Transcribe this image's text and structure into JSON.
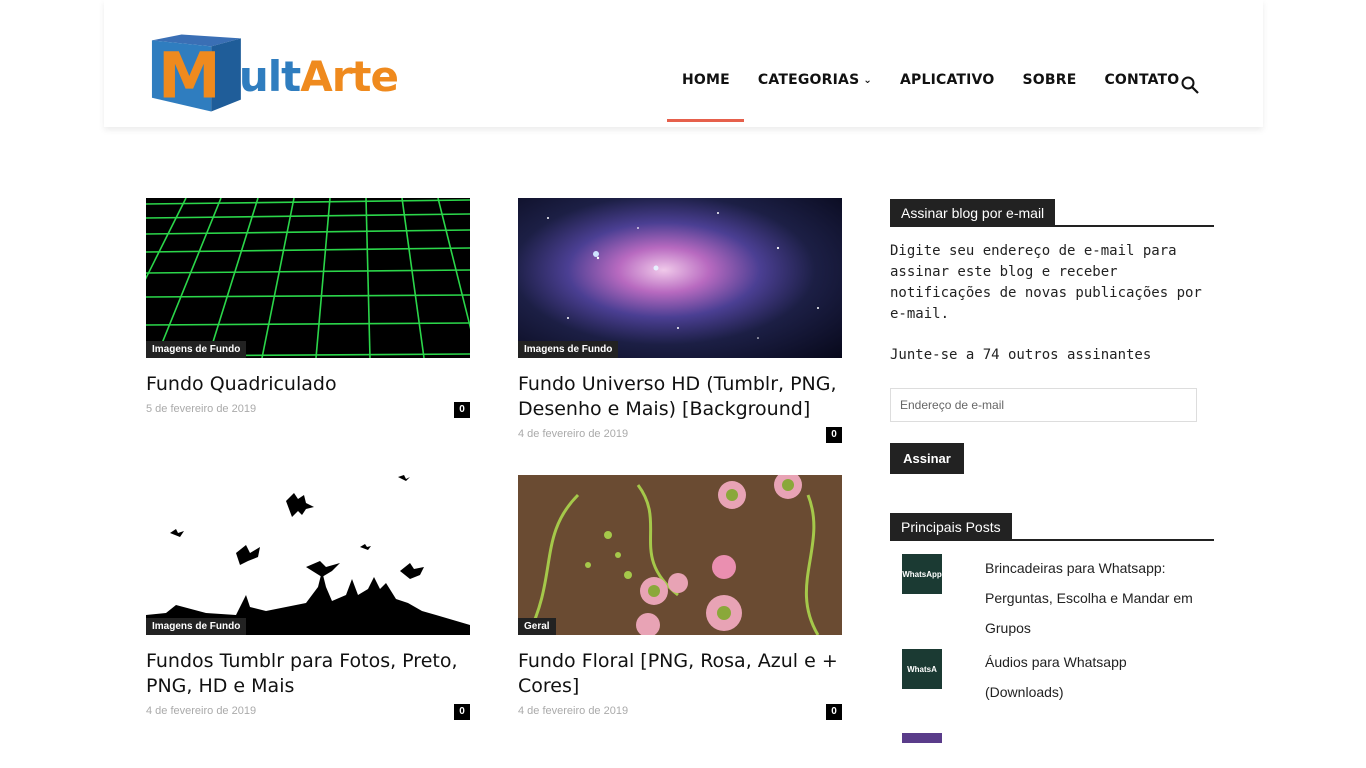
{
  "brand": {
    "logo_text_part1": "ult",
    "logo_text_part2": "Arte",
    "logo_letter": "M"
  },
  "nav": {
    "items": [
      {
        "label": "HOME",
        "active": true
      },
      {
        "label": "CATEGORIAS",
        "has_dropdown": true
      },
      {
        "label": "APLICATIVO"
      },
      {
        "label": "SOBRE"
      },
      {
        "label": "CONTATO"
      }
    ],
    "active_color": "#e6604c"
  },
  "posts": [
    {
      "title": "Fundo Quadriculado",
      "category": "Imagens de Fundo",
      "date": "5 de fevereiro de 2019",
      "comments": "0"
    },
    {
      "title": "Fundo Universo HD (Tumblr, PNG, Desenho e Mais) [Background]",
      "category": "Imagens de Fundo",
      "date": "4 de fevereiro de 2019",
      "comments": "0"
    },
    {
      "title": "Fundos Tumblr para Fotos, Preto, PNG, HD e Mais",
      "category": "Imagens de Fundo",
      "date": "4 de fevereiro de 2019",
      "comments": "0"
    },
    {
      "title": "Fundo Floral [PNG, Rosa, Azul e + Cores]",
      "category": "Geral",
      "date": "4 de fevereiro de 2019",
      "comments": "0"
    }
  ],
  "sidebar": {
    "subscribe": {
      "heading": "Assinar blog por e-mail",
      "description": "Digite seu endereço de e-mail para assinar este blog e receber notificações de novas publicações por e-mail.",
      "subscribers": "Junte-se a 74 outros assinantes",
      "email_placeholder": "Endereço de e-mail",
      "button_label": "Assinar"
    },
    "top_posts": {
      "heading": "Principais Posts",
      "items": [
        {
          "title": "Brincadeiras para Whatsapp: Perguntas, Escolha e Mandar em Grupos",
          "thumb_text": "WhatsApp"
        },
        {
          "title": "Áudios para Whatsapp (Downloads)",
          "thumb_text": "WhatsA"
        }
      ]
    }
  }
}
